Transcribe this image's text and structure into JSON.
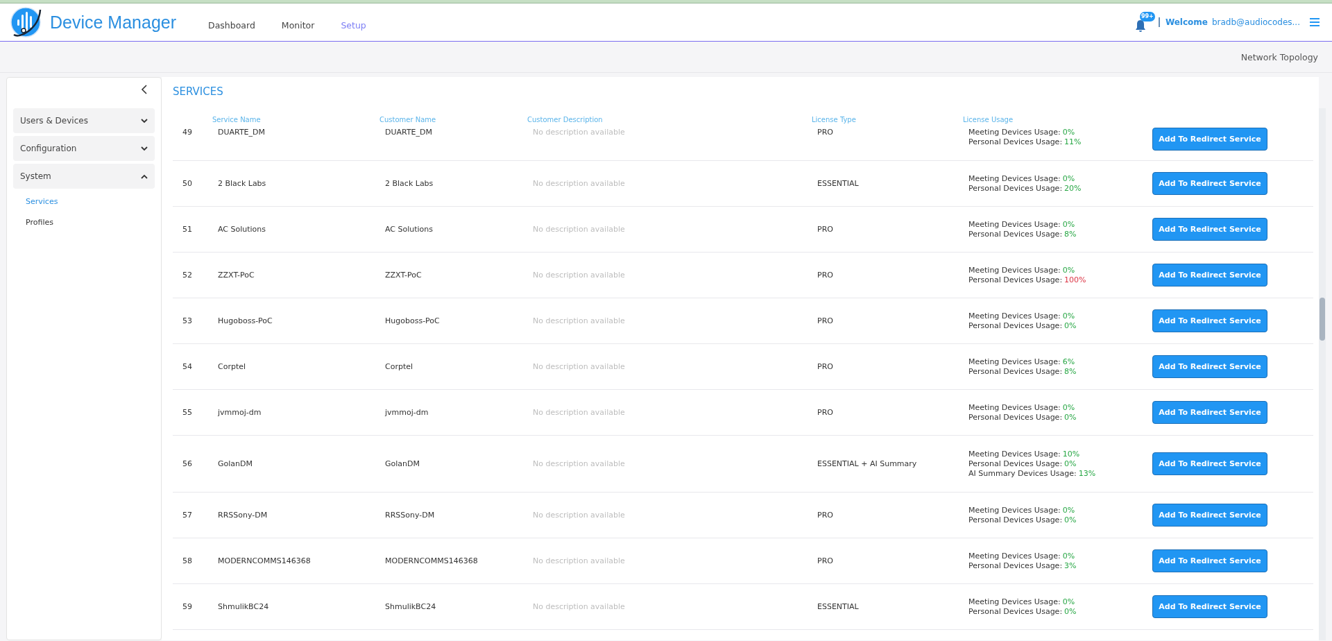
{
  "header": {
    "app_title": "Device Manager",
    "nav": [
      {
        "label": "Dashboard",
        "selected": false
      },
      {
        "label": "Monitor",
        "selected": false
      },
      {
        "label": "Setup",
        "selected": true
      }
    ],
    "notification_badge": "99+",
    "welcome_label": "Welcome",
    "user": "bradb@audiocodes..."
  },
  "subbar": {
    "link": "Network Topology"
  },
  "sidebar": {
    "groups": [
      {
        "label": "Users & Devices",
        "expanded": false
      },
      {
        "label": "Configuration",
        "expanded": false
      },
      {
        "label": "System",
        "expanded": true,
        "children": [
          {
            "label": "Services",
            "selected": true
          },
          {
            "label": "Profiles",
            "selected": false
          }
        ]
      }
    ]
  },
  "page_title": "SERVICES",
  "table": {
    "columns": [
      "Service Name",
      "Customer Name",
      "Customer Description",
      "License Type",
      "License Usage"
    ],
    "rows": [
      {
        "number": "49",
        "service": "DUARTE_DM",
        "customer": "DUARTE_DM",
        "description": "No description available",
        "license": "PRO",
        "usage": [
          {
            "label": "Meeting Devices Usage:",
            "value": "0%",
            "color": "#28a745"
          },
          {
            "label": "Personal Devices Usage:",
            "value": "11%",
            "color": "#28a745"
          }
        ],
        "action": "Add To Redirect Service"
      },
      {
        "number": "50",
        "service": "2 Black Labs",
        "customer": "2 Black Labs",
        "description": "No description available",
        "license": "ESSENTIAL",
        "usage": [
          {
            "label": "Meeting Devices Usage:",
            "value": "0%",
            "color": "#28a745"
          },
          {
            "label": "Personal Devices Usage:",
            "value": "20%",
            "color": "#28a745"
          }
        ],
        "action": "Add To Redirect Service"
      },
      {
        "number": "51",
        "service": "AC Solutions",
        "customer": "AC Solutions",
        "description": "No description available",
        "license": "PRO",
        "usage": [
          {
            "label": "Meeting Devices Usage:",
            "value": "0%",
            "color": "#28a745"
          },
          {
            "label": "Personal Devices Usage:",
            "value": "8%",
            "color": "#28a745"
          }
        ],
        "action": "Add To Redirect Service"
      },
      {
        "number": "52",
        "service": "ZZXT-PoC",
        "customer": "ZZXT-PoC",
        "description": "No description available",
        "license": "PRO",
        "usage": [
          {
            "label": "Meeting Devices Usage:",
            "value": "0%",
            "color": "#28a745"
          },
          {
            "label": "Personal Devices Usage:",
            "value": "100%",
            "color": "#dc3545"
          }
        ],
        "action": "Add To Redirect Service"
      },
      {
        "number": "53",
        "service": "Hugoboss-PoC",
        "customer": "Hugoboss-PoC",
        "description": "No description available",
        "license": "PRO",
        "usage": [
          {
            "label": "Meeting Devices Usage:",
            "value": "0%",
            "color": "#28a745"
          },
          {
            "label": "Personal Devices Usage:",
            "value": "0%",
            "color": "#28a745"
          }
        ],
        "action": "Add To Redirect Service"
      },
      {
        "number": "54",
        "service": "Corptel",
        "customer": "Corptel",
        "description": "No description available",
        "license": "PRO",
        "usage": [
          {
            "label": "Meeting Devices Usage:",
            "value": "6%",
            "color": "#28a745"
          },
          {
            "label": "Personal Devices Usage:",
            "value": "8%",
            "color": "#28a745"
          }
        ],
        "action": "Add To Redirect Service"
      },
      {
        "number": "55",
        "service": "jvmmoj-dm",
        "customer": "jvmmoj-dm",
        "description": "No description available",
        "license": "PRO",
        "usage": [
          {
            "label": "Meeting Devices Usage:",
            "value": "0%",
            "color": "#28a745"
          },
          {
            "label": "Personal Devices Usage:",
            "value": "0%",
            "color": "#28a745"
          }
        ],
        "action": "Add To Redirect Service"
      },
      {
        "number": "56",
        "service": "GolanDM",
        "customer": "GolanDM",
        "description": "No description available",
        "license": "ESSENTIAL + AI Summary",
        "usage": [
          {
            "label": "Meeting Devices Usage:",
            "value": "10%",
            "color": "#28a745"
          },
          {
            "label": "Personal Devices Usage:",
            "value": "0%",
            "color": "#28a745"
          },
          {
            "label": "AI Summary Devices Usage:",
            "value": "13%",
            "color": "#28a745"
          }
        ],
        "action": "Add To Redirect Service"
      },
      {
        "number": "57",
        "service": "RRSSony-DM",
        "customer": "RRSSony-DM",
        "description": "No description available",
        "license": "PRO",
        "usage": [
          {
            "label": "Meeting Devices Usage:",
            "value": "0%",
            "color": "#28a745"
          },
          {
            "label": "Personal Devices Usage:",
            "value": "0%",
            "color": "#28a745"
          }
        ],
        "action": "Add To Redirect Service"
      },
      {
        "number": "58",
        "service": "MODERNCOMMS146368",
        "customer": "MODERNCOMMS146368",
        "description": "No description available",
        "license": "PRO",
        "usage": [
          {
            "label": "Meeting Devices Usage:",
            "value": "0%",
            "color": "#28a745"
          },
          {
            "label": "Personal Devices Usage:",
            "value": "3%",
            "color": "#28a745"
          }
        ],
        "action": "Add To Redirect Service"
      },
      {
        "number": "59",
        "service": "ShmulikBC24",
        "customer": "ShmulikBC24",
        "description": "No description available",
        "license": "ESSENTIAL",
        "usage": [
          {
            "label": "Meeting Devices Usage:",
            "value": "0%",
            "color": "#28a745"
          },
          {
            "label": "Personal Devices Usage:",
            "value": "0%",
            "color": "#28a745"
          }
        ],
        "action": "Add To Redirect Service"
      }
    ]
  }
}
